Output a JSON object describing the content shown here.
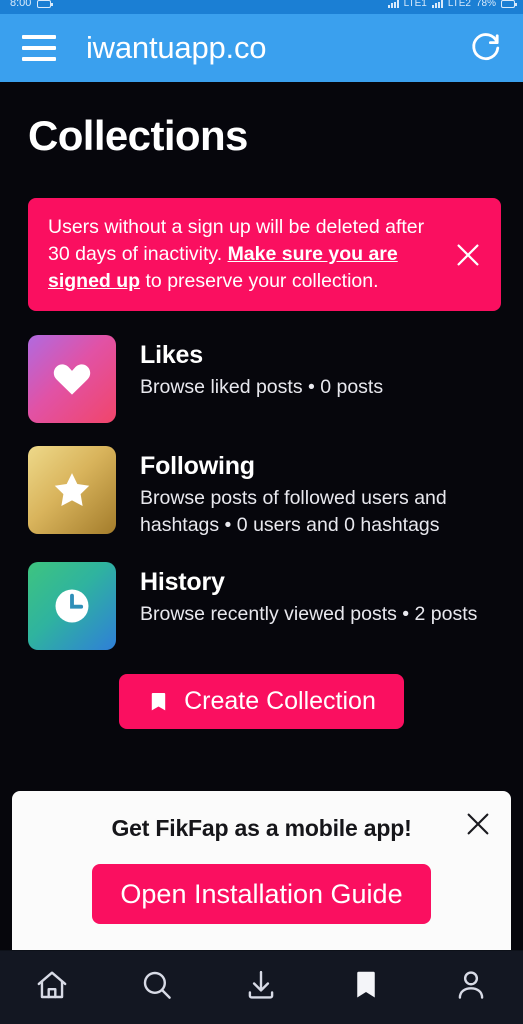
{
  "status_bar": {
    "time": "8:00",
    "carrier_left": "LTE1",
    "carrier_right": "LTE2",
    "battery": "78%"
  },
  "browser": {
    "url": "iwantuapp.co",
    "menu_icon": "hamburger-menu-icon",
    "reload_icon": "reload-icon"
  },
  "page": {
    "title": "Collections"
  },
  "warning_banner": {
    "text_before": "Users without a sign up will be deleted after 30 days of inactivity. ",
    "link_text": "Make sure you are signed up",
    "text_after": " to preserve your collection.",
    "close_icon": "close-icon",
    "background_color": "#FA0F60"
  },
  "collections": [
    {
      "title": "Likes",
      "subtitle": "Browse liked posts • 0 posts",
      "icon": "heart-icon",
      "gradient_from": "#B06AE0",
      "gradient_to": "#F1456A"
    },
    {
      "title": "Following",
      "subtitle": "Browse posts of followed users and hashtags • 0 users and 0 hashtags",
      "icon": "star-icon",
      "gradient_from": "#EED98A",
      "gradient_to": "#A37C2B"
    },
    {
      "title": "History",
      "subtitle": "Browse recently viewed posts • 2 posts",
      "icon": "clock-icon",
      "gradient_from": "#3EC47F",
      "gradient_to": "#2F7FD8"
    }
  ],
  "create_button": {
    "label": "Create Collection",
    "icon": "bookmark-icon",
    "color": "#FA0F60"
  },
  "install_banner": {
    "title": "Get FikFap as a mobile app!",
    "button_label": "Open Installation Guide",
    "close_icon": "close-icon",
    "background_color": "#FBFBFB"
  },
  "bottom_nav": {
    "items": [
      {
        "name": "home",
        "icon": "home-icon",
        "active": false
      },
      {
        "name": "search",
        "icon": "search-icon",
        "active": false
      },
      {
        "name": "downloads",
        "icon": "download-icon",
        "active": false
      },
      {
        "name": "collections",
        "icon": "bookmark-icon",
        "active": true
      },
      {
        "name": "profile",
        "icon": "person-icon",
        "active": false
      }
    ]
  }
}
